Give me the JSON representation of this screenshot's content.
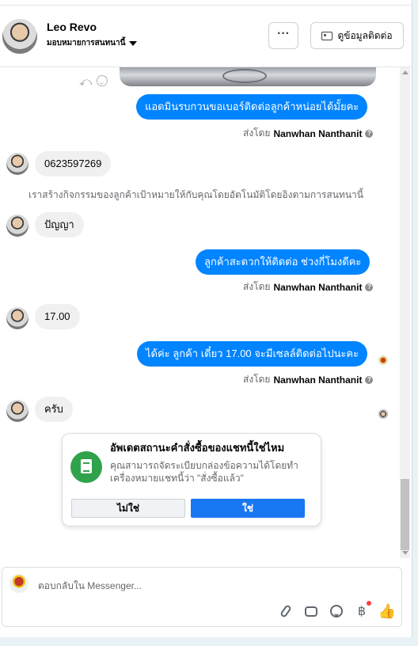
{
  "header": {
    "name": "Leo Revo",
    "subtitle": "มอบหมายการสนทนานี้",
    "more_label": "···",
    "info_label": "ดูข้อมูลติดต่อ"
  },
  "messages": [
    {
      "dir": "out",
      "text": "แอดมินรบกวนขอเบอร์ติดต่อลูกค้าหน่อยได้มั้ยคะ"
    },
    {
      "dir": "in",
      "text": "0623597269"
    },
    {
      "dir": "system",
      "text": "เราสร้างกิจกรรมของลูกค้าเป้าหมายให้กับคุณโดยอัตโนมัติโดยอิงตามการสนทนานี้"
    },
    {
      "dir": "in",
      "text": "ปัญญา"
    },
    {
      "dir": "out",
      "text": "ลูกค้าสะดวกให้ติดต่อ ช่วงกี่โมงดีคะ"
    },
    {
      "dir": "in",
      "text": "17.00"
    },
    {
      "dir": "out",
      "text": "ได้ค่ะ ลูกค้า เดี๋ยว 17.00 จะมีเซลล์ติดต่อไปนะคะ"
    },
    {
      "dir": "in",
      "text": "ครับ"
    }
  ],
  "sent_by": {
    "prefix": "ส่งโดย",
    "agent": "Nanwhan Nanthanit",
    "help": "?"
  },
  "card": {
    "title": "อัพเดตสถานะคำสั่งซื้อของแชทนี้ใช่ไหม",
    "description": "คุณสามารถจัดระเบียบกล่องข้อความได้โดยทำเครื่องหมายแชทนี้ว่า \"สั่งซื้อแล้ว\"",
    "no_label": "ไม่ใช่",
    "yes_label": "ใช่"
  },
  "composer": {
    "placeholder": "ตอบกลับใน Messenger...",
    "tools": [
      "paperclip-icon",
      "chat-bubble-icon",
      "emoji-icon",
      "currency-icon",
      "thumbs-up-icon"
    ],
    "currency_symbol": "฿"
  },
  "colors": {
    "accent": "#0084ff",
    "primary_button": "#1877f2",
    "card_icon": "#31a24c"
  }
}
